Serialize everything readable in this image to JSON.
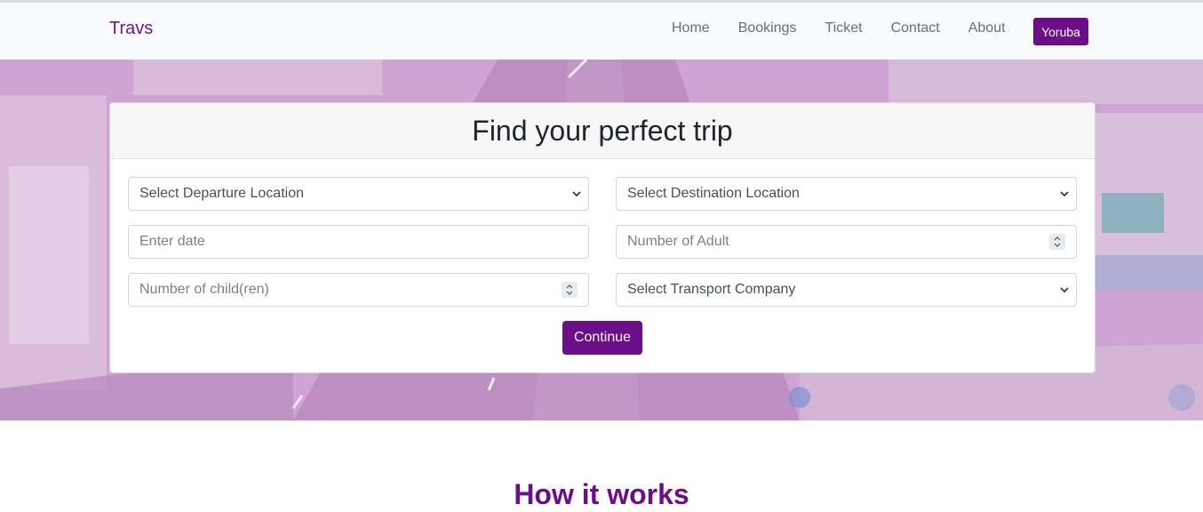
{
  "brand": "Travs",
  "nav": {
    "links": [
      "Home",
      "Bookings",
      "Ticket",
      "Contact",
      "About"
    ],
    "language_button": "Yoruba"
  },
  "colors": {
    "accent": "#6a0f87",
    "hero_overlay": "#c99ccd",
    "navbar_bg": "#f8f9fa"
  },
  "search": {
    "title": "Find your perfect trip",
    "departure": "Select Departure Location",
    "destination": "Select Destination Location",
    "date_placeholder": "Enter date",
    "adults_placeholder": "Number of Adult",
    "children_placeholder": "Number of child(ren)",
    "company": "Select Transport Company",
    "submit": "Continue"
  },
  "sections": {
    "how_it_works": "How it works"
  }
}
